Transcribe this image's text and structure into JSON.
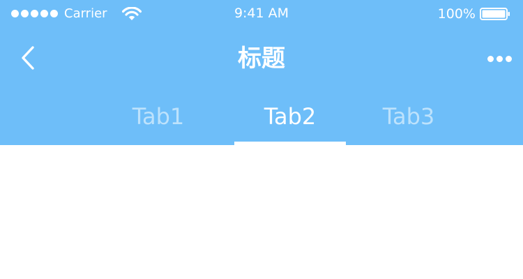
{
  "status_bar": {
    "carrier": "Carrier",
    "time": "9:41 AM",
    "battery": "100%",
    "signal_icon": "signal-dots-icon",
    "wifi_icon": "wifi-icon",
    "battery_icon": "battery-full-icon"
  },
  "nav": {
    "title": "标题",
    "back_icon": "chevron-left-icon",
    "more_icon": "more-horizontal-icon"
  },
  "tabs": [
    {
      "label": "Tab1",
      "active": false
    },
    {
      "label": "Tab2",
      "active": true
    },
    {
      "label": "Tab3",
      "active": false
    }
  ],
  "colors": {
    "header_background": "#6ebef9",
    "active_tab": "#ffffff",
    "inactive_tab": "rgba(255,255,255,0.55)",
    "content_background": "#ffffff"
  }
}
